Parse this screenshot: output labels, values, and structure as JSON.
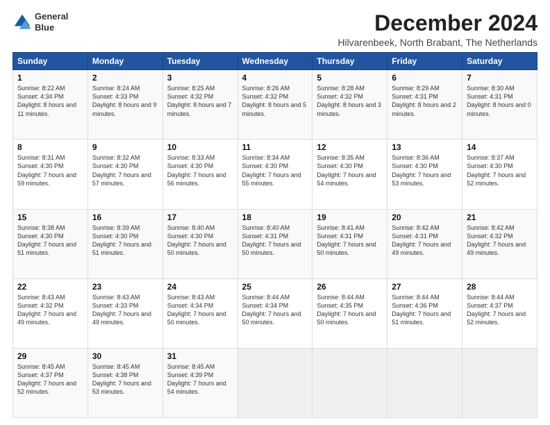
{
  "logo": {
    "line1": "General",
    "line2": "Blue"
  },
  "title": "December 2024",
  "subtitle": "Hilvarenbeek, North Brabant, The Netherlands",
  "days_of_week": [
    "Sunday",
    "Monday",
    "Tuesday",
    "Wednesday",
    "Thursday",
    "Friday",
    "Saturday"
  ],
  "weeks": [
    [
      {
        "day": "1",
        "sunrise": "8:22 AM",
        "sunset": "4:34 PM",
        "daylight": "8 hours and 11 minutes."
      },
      {
        "day": "2",
        "sunrise": "8:24 AM",
        "sunset": "4:33 PM",
        "daylight": "8 hours and 9 minutes."
      },
      {
        "day": "3",
        "sunrise": "8:25 AM",
        "sunset": "4:32 PM",
        "daylight": "8 hours and 7 minutes."
      },
      {
        "day": "4",
        "sunrise": "8:26 AM",
        "sunset": "4:32 PM",
        "daylight": "8 hours and 5 minutes."
      },
      {
        "day": "5",
        "sunrise": "8:28 AM",
        "sunset": "4:32 PM",
        "daylight": "8 hours and 3 minutes."
      },
      {
        "day": "6",
        "sunrise": "8:29 AM",
        "sunset": "4:31 PM",
        "daylight": "8 hours and 2 minutes."
      },
      {
        "day": "7",
        "sunrise": "8:30 AM",
        "sunset": "4:31 PM",
        "daylight": "8 hours and 0 minutes."
      }
    ],
    [
      {
        "day": "8",
        "sunrise": "8:31 AM",
        "sunset": "4:30 PM",
        "daylight": "7 hours and 59 minutes."
      },
      {
        "day": "9",
        "sunrise": "8:32 AM",
        "sunset": "4:30 PM",
        "daylight": "7 hours and 57 minutes."
      },
      {
        "day": "10",
        "sunrise": "8:33 AM",
        "sunset": "4:30 PM",
        "daylight": "7 hours and 56 minutes."
      },
      {
        "day": "11",
        "sunrise": "8:34 AM",
        "sunset": "4:30 PM",
        "daylight": "7 hours and 55 minutes."
      },
      {
        "day": "12",
        "sunrise": "8:35 AM",
        "sunset": "4:30 PM",
        "daylight": "7 hours and 54 minutes."
      },
      {
        "day": "13",
        "sunrise": "8:36 AM",
        "sunset": "4:30 PM",
        "daylight": "7 hours and 53 minutes."
      },
      {
        "day": "14",
        "sunrise": "8:37 AM",
        "sunset": "4:30 PM",
        "daylight": "7 hours and 52 minutes."
      }
    ],
    [
      {
        "day": "15",
        "sunrise": "8:38 AM",
        "sunset": "4:30 PM",
        "daylight": "7 hours and 51 minutes."
      },
      {
        "day": "16",
        "sunrise": "8:39 AM",
        "sunset": "4:30 PM",
        "daylight": "7 hours and 51 minutes."
      },
      {
        "day": "17",
        "sunrise": "8:40 AM",
        "sunset": "4:30 PM",
        "daylight": "7 hours and 50 minutes."
      },
      {
        "day": "18",
        "sunrise": "8:40 AM",
        "sunset": "4:31 PM",
        "daylight": "7 hours and 50 minutes."
      },
      {
        "day": "19",
        "sunrise": "8:41 AM",
        "sunset": "4:31 PM",
        "daylight": "7 hours and 50 minutes."
      },
      {
        "day": "20",
        "sunrise": "8:42 AM",
        "sunset": "4:31 PM",
        "daylight": "7 hours and 49 minutes."
      },
      {
        "day": "21",
        "sunrise": "8:42 AM",
        "sunset": "4:32 PM",
        "daylight": "7 hours and 49 minutes."
      }
    ],
    [
      {
        "day": "22",
        "sunrise": "8:43 AM",
        "sunset": "4:32 PM",
        "daylight": "7 hours and 49 minutes."
      },
      {
        "day": "23",
        "sunrise": "8:43 AM",
        "sunset": "4:33 PM",
        "daylight": "7 hours and 49 minutes."
      },
      {
        "day": "24",
        "sunrise": "8:43 AM",
        "sunset": "4:34 PM",
        "daylight": "7 hours and 50 minutes."
      },
      {
        "day": "25",
        "sunrise": "8:44 AM",
        "sunset": "4:34 PM",
        "daylight": "7 hours and 50 minutes."
      },
      {
        "day": "26",
        "sunrise": "8:44 AM",
        "sunset": "4:35 PM",
        "daylight": "7 hours and 50 minutes."
      },
      {
        "day": "27",
        "sunrise": "8:44 AM",
        "sunset": "4:36 PM",
        "daylight": "7 hours and 51 minutes."
      },
      {
        "day": "28",
        "sunrise": "8:44 AM",
        "sunset": "4:37 PM",
        "daylight": "7 hours and 52 minutes."
      }
    ],
    [
      {
        "day": "29",
        "sunrise": "8:45 AM",
        "sunset": "4:37 PM",
        "daylight": "7 hours and 52 minutes."
      },
      {
        "day": "30",
        "sunrise": "8:45 AM",
        "sunset": "4:38 PM",
        "daylight": "7 hours and 53 minutes."
      },
      {
        "day": "31",
        "sunrise": "8:45 AM",
        "sunset": "4:39 PM",
        "daylight": "7 hours and 54 minutes."
      },
      null,
      null,
      null,
      null
    ]
  ]
}
